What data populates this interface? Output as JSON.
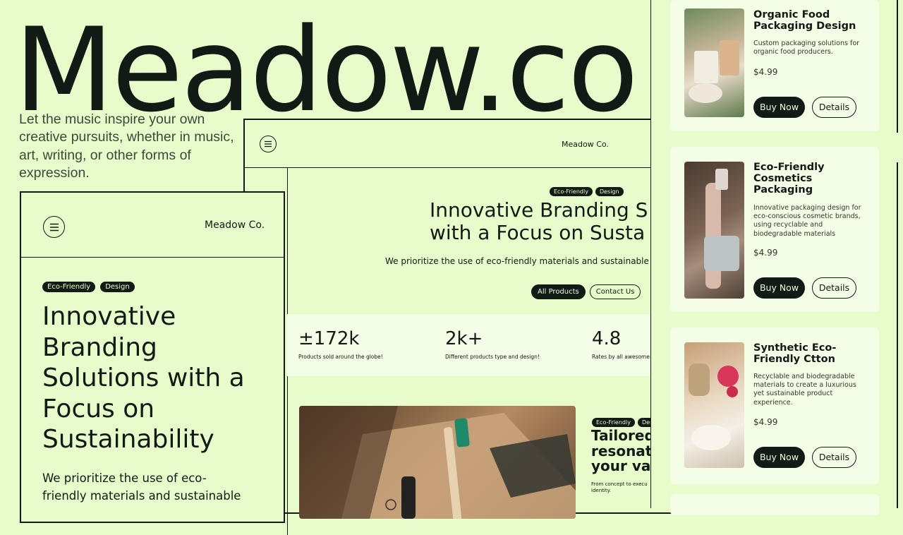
{
  "hero": {
    "brand_title": "Meadow.co",
    "tagline": "Let the music inspire your own creative pursuits, whether in music, art, writing, or other forms of expression."
  },
  "mid_frame": {
    "brand": "Meadow Co.",
    "chips": [
      "Eco-Friendly",
      "Design"
    ],
    "headline_line1": "Innovative Branding S",
    "headline_line2": "with a Focus on Susta",
    "subtitle": "We prioritize the use of eco-friendly materials and sustainable d",
    "cta_primary": "All Products",
    "cta_secondary": "Contact Us",
    "stats": [
      {
        "value": "±172k",
        "label": "Products sold around the globe!"
      },
      {
        "value": "2k+",
        "label": "Different products type and design!"
      },
      {
        "value": "4.8",
        "label": "Rates by all awesome"
      }
    ],
    "feature_chips": [
      "Eco-Friendly",
      "Desi"
    ],
    "feature_heading_1": "Tailored",
    "feature_heading_2": "resonate",
    "feature_heading_3": "your valu",
    "feature_body": "From concept to execu identity."
  },
  "left_frame": {
    "brand": "Meadow Co.",
    "chips": [
      "Eco-Friendly",
      "Design"
    ],
    "headline": "Innovative Branding Solutions with a Focus on Sustainability",
    "body": "We prioritize the use of eco-friendly materials and sustainable"
  },
  "products": [
    {
      "title": "Organic Food Packaging Design",
      "description": "Custom packaging solutions for organic food producers.",
      "price": "$4.99",
      "buy_label": "Buy Now",
      "details_label": "Details"
    },
    {
      "title": "Eco-Friendly Cosmetics Packaging",
      "description": "Innovative packaging design for eco-conscious cosmetic brands, using recyclable and biodegradable materials",
      "price": "$4.99",
      "buy_label": "Buy Now",
      "details_label": "Details"
    },
    {
      "title": "Synthetic Eco-Friendly Ctton",
      "description": "Recyclable and biodegradable materials to create a luxurious yet sustainable product experience.",
      "price": "$4.99",
      "buy_label": "Buy Now",
      "details_label": "Details"
    }
  ],
  "icons": {
    "menu": "menu-icon",
    "leaf": "leaf-icon"
  },
  "colors": {
    "background": "#e8fbcb",
    "ink": "#111a14",
    "card": "#f4fde6"
  }
}
